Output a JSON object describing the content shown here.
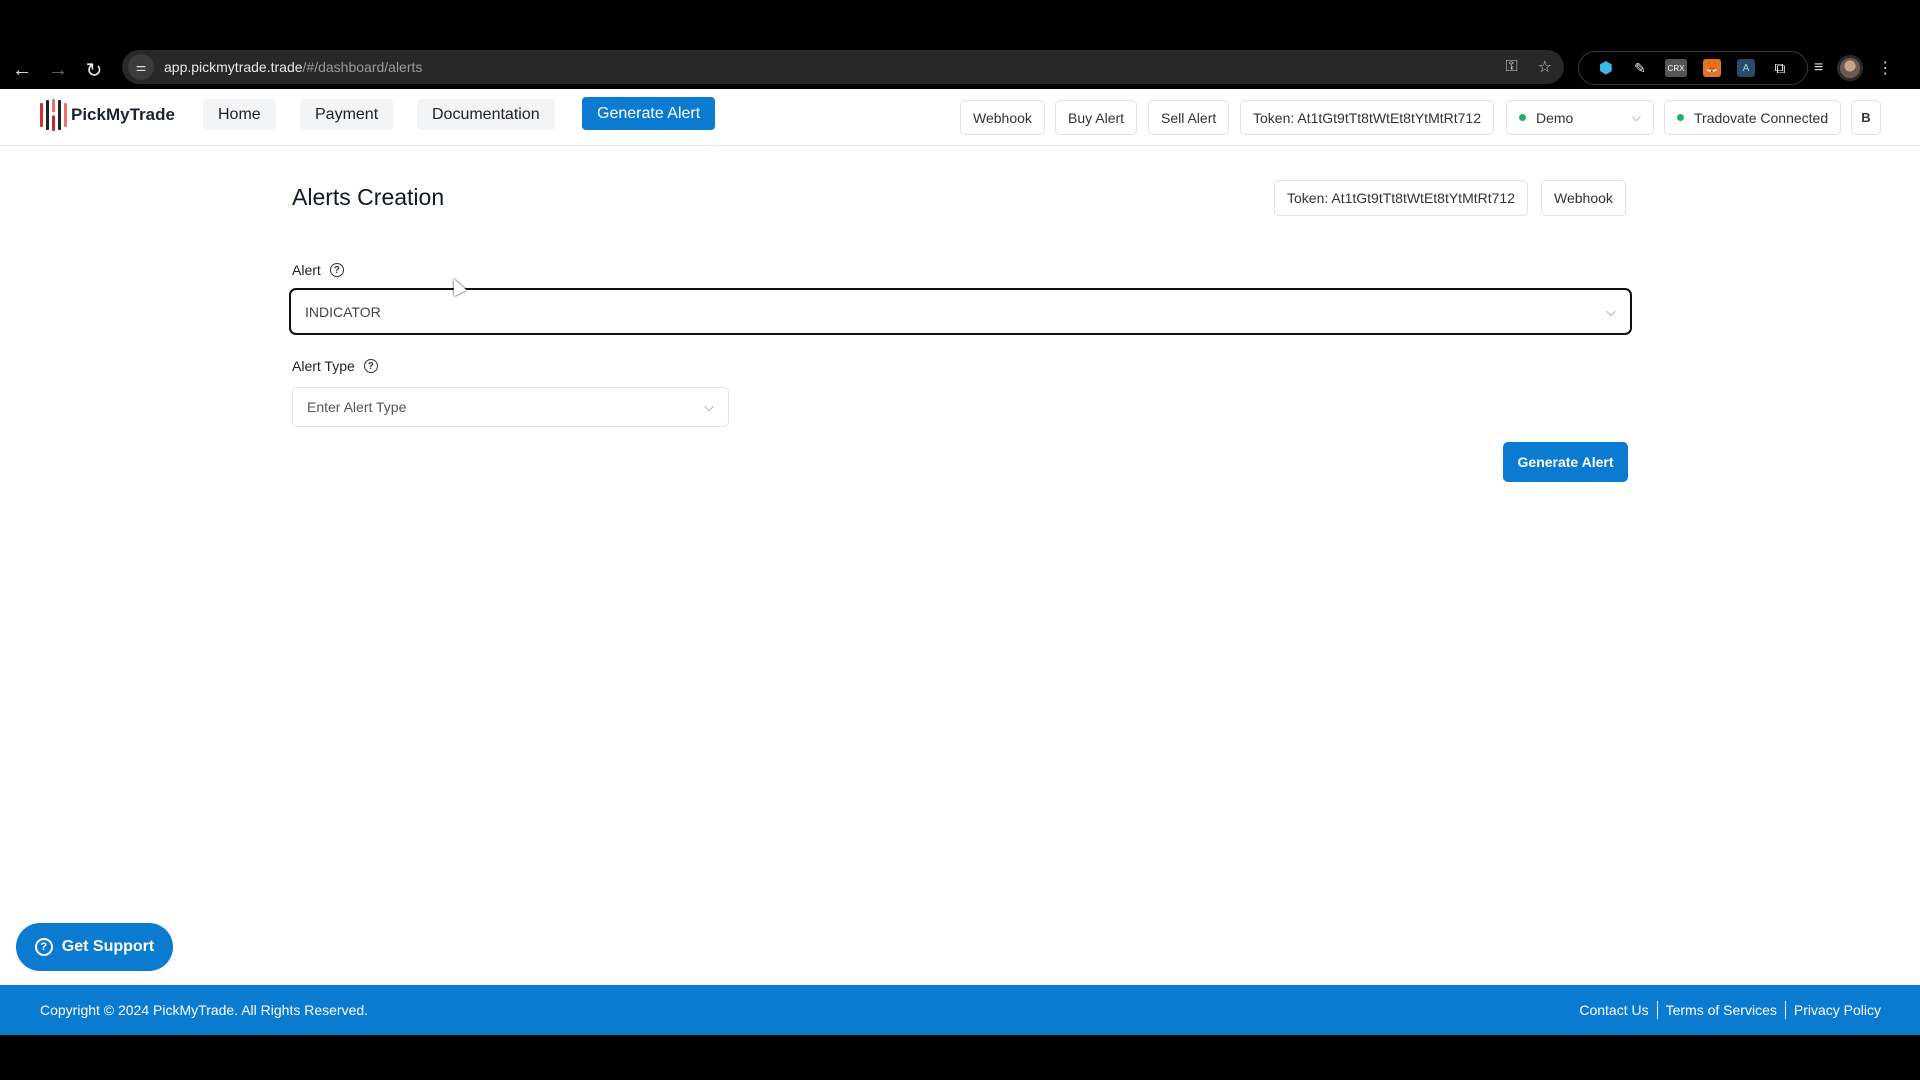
{
  "browser": {
    "url_host": "app.pickmytrade.trade",
    "url_path": "/#/dashboard/alerts",
    "icons": [
      "back-icon",
      "forward-icon",
      "reload-icon",
      "site-info-icon",
      "password-key-icon",
      "bookmark-star-icon",
      "extension-web-icon",
      "extension-broom-icon",
      "extension-crx-icon",
      "extension-metamask-icon",
      "extension-a-icon",
      "extensions-puzzle-icon",
      "media-queue-icon",
      "profile-avatar",
      "menu-kebab-icon"
    ],
    "ext_crx_label": "CRX",
    "ext_a_label": "A"
  },
  "nav": {
    "brand": "PickMyTrade",
    "logo_colors": [
      "#d32f2f",
      "#222222",
      "#e57368",
      "#222222",
      "#e57368"
    ],
    "menu": [
      {
        "label": "Home"
      },
      {
        "label": "Payment"
      },
      {
        "label": "Documentation"
      },
      {
        "label": "Generate Alert"
      }
    ],
    "actions": {
      "webhook": "Webhook",
      "buy_alert": "Buy Alert",
      "sell_alert": "Sell Alert",
      "token": "Token: At1tGt9tTt8tWtEt8tYtMtRt712",
      "account_select": "Demo",
      "connection_status": "Tradovate Connected",
      "user_initial": "B"
    },
    "status_color": "#22b065"
  },
  "page": {
    "title": "Alerts Creation",
    "token_button": "Token: At1tGt9tTt8tWtEt8tYtMtRt712",
    "webhook_button": "Webhook",
    "alert_label": "Alert",
    "alert_value": "INDICATOR",
    "alert_type_label": "Alert Type",
    "alert_type_placeholder": "Enter Alert Type",
    "generate_button": "Generate Alert"
  },
  "support": {
    "label": "Get Support"
  },
  "footer": {
    "copyright": "Copyright © 2024 PickMyTrade. All Rights Reserved.",
    "links": [
      "Contact Us",
      "Terms of Services",
      "Privacy Policy"
    ]
  },
  "colors": {
    "brand_blue": "#0a7bd1"
  }
}
